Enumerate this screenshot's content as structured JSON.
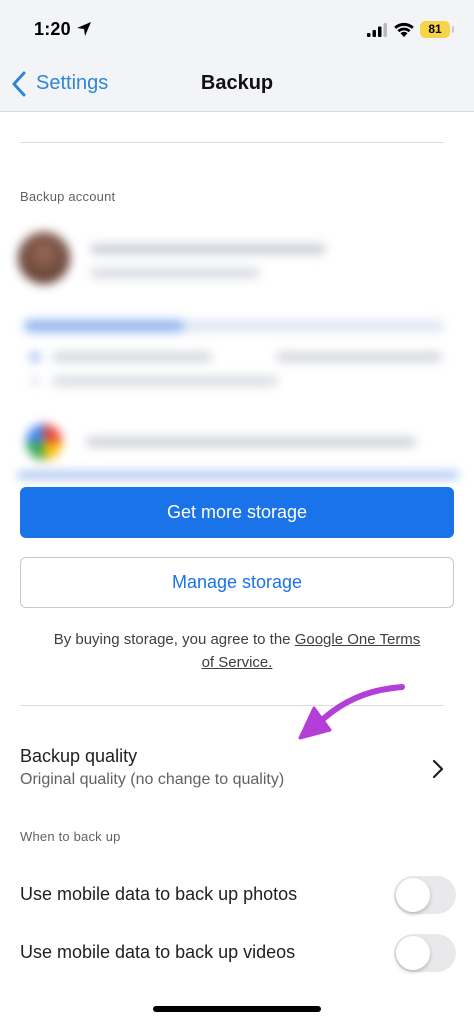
{
  "status_bar": {
    "time": "1:20",
    "battery": "81",
    "icons": [
      "location-arrow-icon",
      "signal-icon",
      "wifi-icon",
      "battery-icon"
    ]
  },
  "nav": {
    "back_label": "Settings",
    "title": "Backup"
  },
  "backup_account": {
    "label": "Backup account"
  },
  "buttons": {
    "get_more_storage": "Get more storage",
    "manage_storage": "Manage storage"
  },
  "terms": {
    "prefix": "By buying storage, you agree to the ",
    "link_1": "Google One Terms",
    "link_2": "of Service."
  },
  "backup_quality": {
    "title": "Backup quality",
    "value": "Original quality (no change to quality)"
  },
  "when_to_back_up": {
    "label": "When to back up",
    "items": [
      {
        "label": "Use mobile data to back up photos",
        "enabled": false
      },
      {
        "label": "Use mobile data to back up videos",
        "enabled": false
      }
    ]
  },
  "colors": {
    "accent": "#1a73e8",
    "ios_link": "#2e86d6",
    "annotation_arrow": "#b33ed8"
  }
}
